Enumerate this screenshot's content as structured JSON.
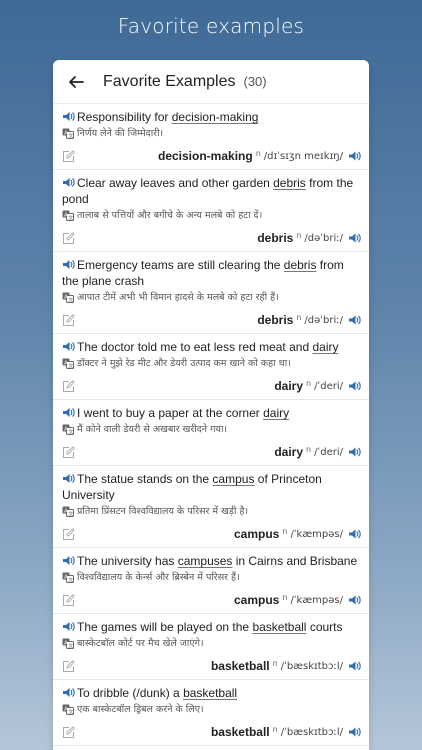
{
  "banner": {
    "title": "Favorite examples"
  },
  "header": {
    "title": "Favorite Examples",
    "count": "(30)"
  },
  "colors": {
    "accent": "#2f6fb3",
    "bg_top": "#3e6a96",
    "bg_bottom": "#b5c6d8"
  },
  "items": [
    {
      "pre": "Responsibility for ",
      "hl": "decision-making",
      "post": "",
      "translation": "निर्णय लेने की जिम्मेदारी।",
      "word": "decision-making",
      "pos": "n",
      "ipa": "/dɪˈsɪʒn meɪkɪŋ/"
    },
    {
      "pre": "Clear away leaves and other garden ",
      "hl": "debris",
      "post": " from the pond",
      "translation": "तालाब से पत्तियों और बगीचे के अन्य मलबे को हटा दें।",
      "word": "debris",
      "pos": "n",
      "ipa": "/dəˈbriː/"
    },
    {
      "pre": "Emergency teams are still clearing the ",
      "hl": "debris",
      "post": " from the plane crash",
      "translation": "आपात टीमें अभी भी विमान हादसे के मलबे को हटा रही हैं।",
      "word": "debris",
      "pos": "n",
      "ipa": "/dəˈbriː/"
    },
    {
      "pre": "The doctor told me to eat less red meat and ",
      "hl": "dairy",
      "post": "",
      "translation": "डॉक्टर ने मुझे रेड मीट और डेयरी उत्पाद कम खाने को कहा था।",
      "word": "dairy",
      "pos": "n",
      "ipa": "/ˈderi/"
    },
    {
      "pre": "I went to buy a paper at the corner ",
      "hl": "dairy",
      "post": "",
      "translation": "मैं कोने वाली डेयरी से अखबार खरीदने गया।",
      "word": "dairy",
      "pos": "n",
      "ipa": "/ˈderi/"
    },
    {
      "pre": "The statue stands on the ",
      "hl": "campus",
      "post": " of Princeton University",
      "translation": "प्रतिमा प्रिंसटन विश्वविद्यालय के परिसर में खड़ी है।",
      "word": "campus",
      "pos": "n",
      "ipa": "/ˈkæmpəs/"
    },
    {
      "pre": "The university has ",
      "hl": "campuses",
      "post": " in Cairns and Brisbane",
      "translation": "विश्वविद्यालय के केर्न्स और ब्रिस्बेन में परिसर हैं।",
      "word": "campus",
      "pos": "n",
      "ipa": "/ˈkæmpəs/"
    },
    {
      "pre": "The games will be played on the ",
      "hl": "basketball",
      "post": " courts",
      "translation": "बास्केटबॉल कोर्ट पर मैच खेले जाएंगे।",
      "word": "basketball",
      "pos": "n",
      "ipa": "/ˈbæskɪtbɔːl/"
    },
    {
      "pre": "To dribble (/dunk) a ",
      "hl": "basketball",
      "post": "",
      "translation": "एक बास्केटबॉल ड्रिबल करने के लिए।",
      "word": "basketball",
      "pos": "n",
      "ipa": "/ˈbæskɪtbɔːl/"
    }
  ]
}
